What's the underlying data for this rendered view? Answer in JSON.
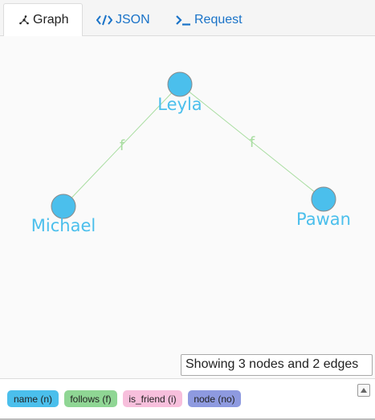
{
  "tabs": [
    {
      "label": "Graph",
      "icon": "graph-icon",
      "active": true
    },
    {
      "label": "JSON",
      "icon": "code-icon",
      "active": false
    },
    {
      "label": "Request",
      "icon": "terminal-icon",
      "active": false
    }
  ],
  "graph": {
    "nodes": [
      {
        "label": "Leyla"
      },
      {
        "label": "Michael"
      },
      {
        "label": "Pawan"
      }
    ],
    "edges": [
      {
        "label": "f"
      },
      {
        "label": "f"
      }
    ],
    "node_color": "#4bbfec",
    "edge_color": "#a8dda0",
    "label_color": "#4bbfec"
  },
  "status": "Showing 3 nodes and 2 edges",
  "legend": [
    {
      "label": "name (n)",
      "color": "#4bbfec"
    },
    {
      "label": "follows (f)",
      "color": "#8fd694"
    },
    {
      "label": "is_friend (i)",
      "color": "#f7bfdc"
    },
    {
      "label": "node (no)",
      "color": "#8e9ae0"
    }
  ],
  "legend_toggle_icon": "collapse-up-icon"
}
